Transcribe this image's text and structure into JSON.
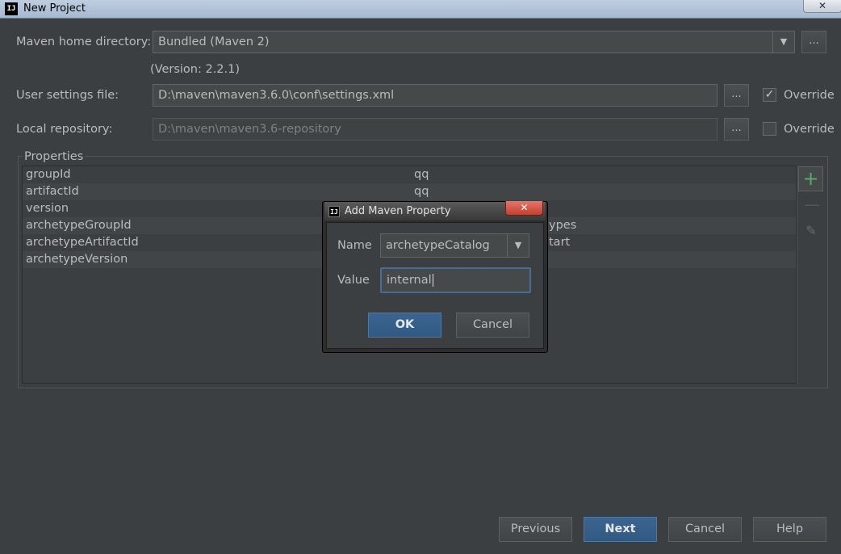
{
  "window": {
    "title": "New Project",
    "logo_text": "IJ",
    "close_glyph": "✕"
  },
  "maven": {
    "home_label": "Maven home directory:",
    "home_value": "Bundled (Maven 2)",
    "version_note": "(Version: 2.2.1)",
    "user_settings_label": "User settings file:",
    "user_settings_value": "D:\\maven\\maven3.6.0\\conf\\settings.xml",
    "user_settings_override": true,
    "local_repo_label": "Local repository:",
    "local_repo_value": "D:\\maven\\maven3.6-repository",
    "local_repo_override": false,
    "override_label": "Override",
    "browse_label": "..."
  },
  "properties": {
    "group_label": "Properties",
    "rows": [
      {
        "key": "groupId",
        "value": "qq"
      },
      {
        "key": "artifactId",
        "value": "qq"
      },
      {
        "key": "version",
        "value": ""
      },
      {
        "key": "archetypeGroupId",
        "value": "ypes"
      },
      {
        "key": "archetypeArtifactId",
        "value": "tart"
      },
      {
        "key": "archetypeVersion",
        "value": ""
      }
    ],
    "add_glyph": "+",
    "remove_glyph": "—",
    "edit_glyph": "✎"
  },
  "dialog": {
    "title": "Add Maven Property",
    "logo_text": "IJ",
    "close_glyph": "✕",
    "name_label": "Name",
    "name_value": "archetypeCatalog",
    "value_label": "Value",
    "value_value": "internal",
    "ok_label": "OK",
    "cancel_label": "Cancel"
  },
  "footer": {
    "previous_label": "Previous",
    "next_label": "Next",
    "cancel_label": "Cancel",
    "help_label": "Help"
  },
  "colors": {
    "background": "#3c3f41",
    "accent": "#466d94",
    "add_green": "#59a869"
  }
}
